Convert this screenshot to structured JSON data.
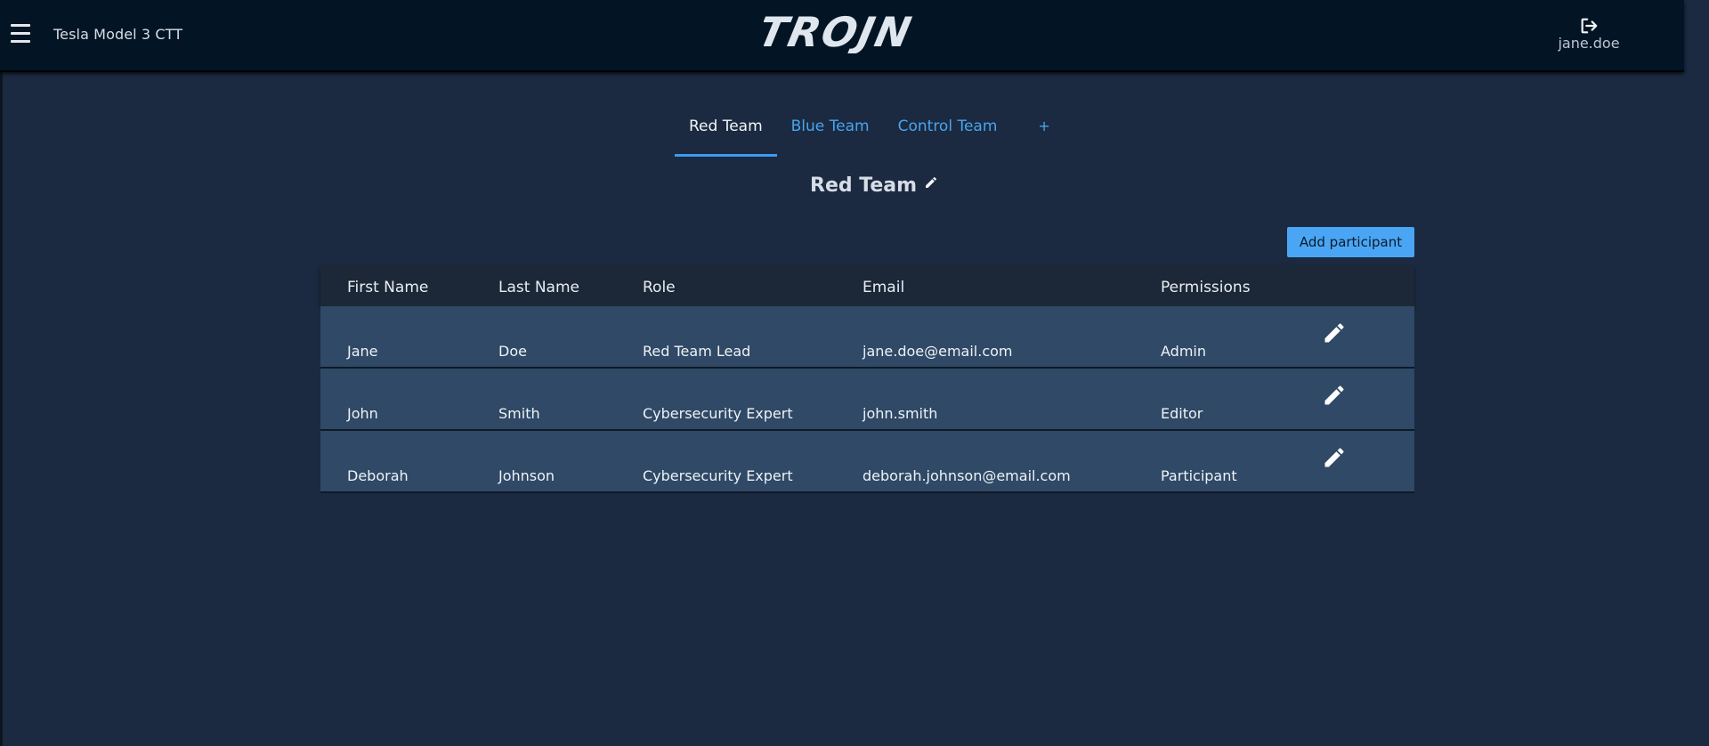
{
  "header": {
    "menu_icon": "hamburger-menu-icon",
    "project_title": "Tesla Model 3 CTT",
    "logo_text": "TROJN",
    "logout_icon": "logout-icon",
    "username": "jane.doe"
  },
  "tabs": [
    {
      "label": "Red Team",
      "active": true
    },
    {
      "label": "Blue Team",
      "active": false
    },
    {
      "label": "Control Team",
      "active": false
    },
    {
      "label": "+",
      "active": false
    }
  ],
  "team": {
    "title": "Red Team",
    "edit_icon": "pencil-icon"
  },
  "actions": {
    "add_participant": "Add participant"
  },
  "table": {
    "columns": [
      "First Name",
      "Last Name",
      "Role",
      "Email",
      "Permissions"
    ],
    "rows": [
      {
        "first": "Jane",
        "last": "Doe",
        "role": "Red Team Lead",
        "email": "jane.doe@email.com",
        "permissions": "Admin"
      },
      {
        "first": "John",
        "last": "Smith",
        "role": "Cybersecurity Expert",
        "email": "john.smith",
        "permissions": "Editor"
      },
      {
        "first": "Deborah",
        "last": "Johnson",
        "role": "Cybersecurity Expert",
        "email": "deborah.johnson@email.com",
        "permissions": "Participant"
      }
    ]
  },
  "colors": {
    "background": "#1b2a40",
    "header": "#031524",
    "accent": "#4aa6f5",
    "row": "#2f4966"
  }
}
